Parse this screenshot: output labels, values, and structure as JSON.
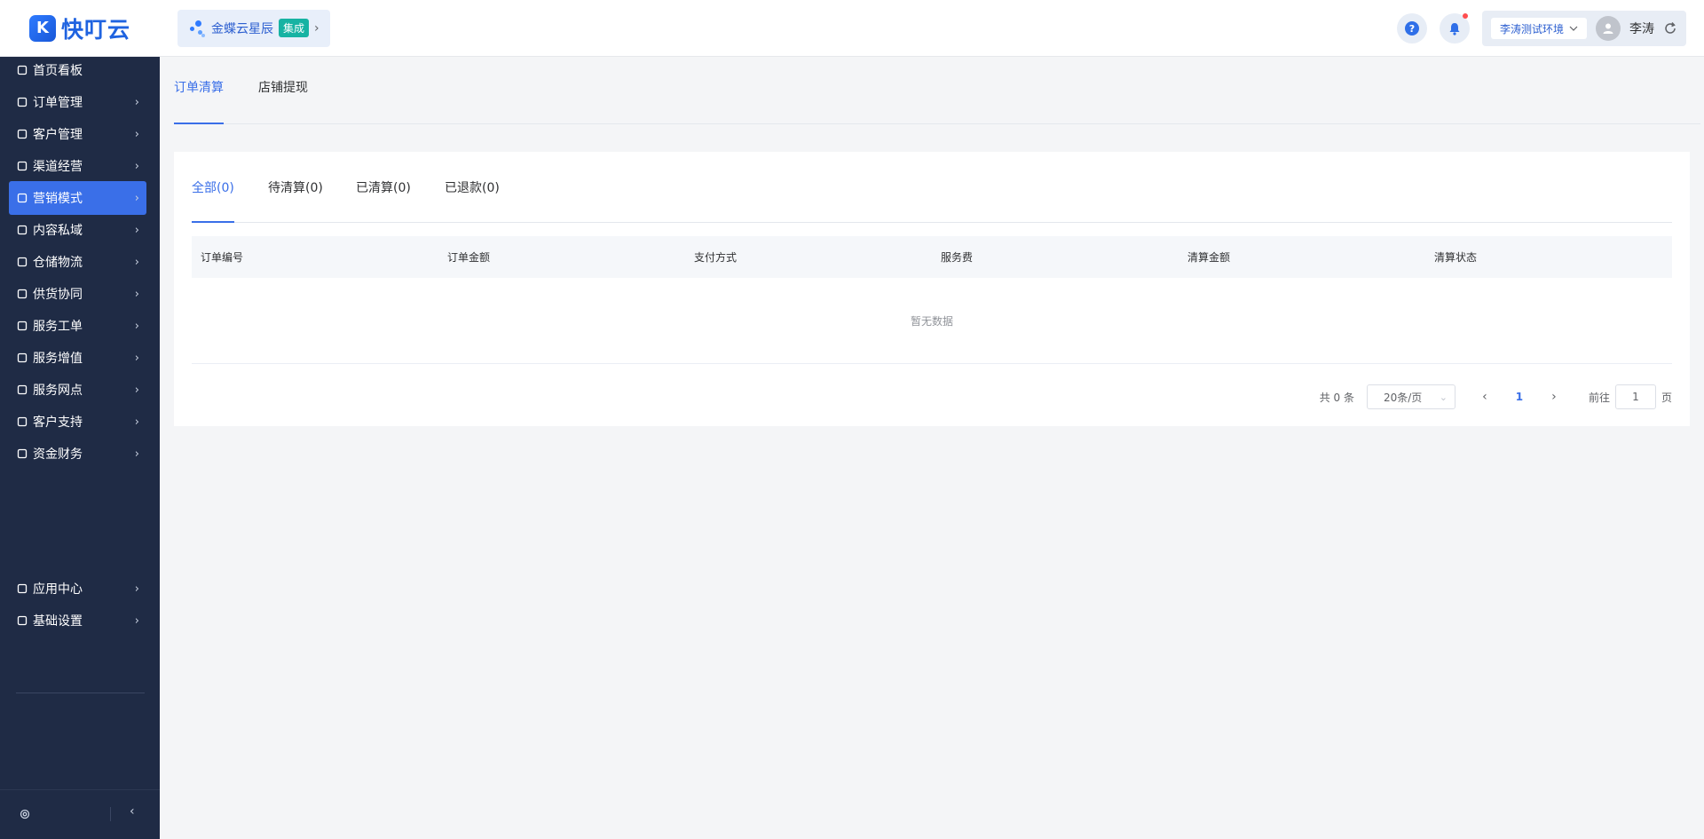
{
  "brand": {
    "logo_glyph": "K",
    "name": "快叮云",
    "color": "#1f63e0"
  },
  "integration": {
    "name": "金蝶云星辰",
    "badge": "集成"
  },
  "header": {
    "env": "李涛测试环境",
    "user": "李涛"
  },
  "sidebar": {
    "items": [
      {
        "label": "首页看板",
        "icon": "home-icon"
      },
      {
        "label": "订单管理",
        "icon": "order-icon"
      },
      {
        "label": "客户管理",
        "icon": "customer-icon"
      },
      {
        "label": "渠道经营",
        "icon": "channel-icon"
      },
      {
        "label": "营销模式",
        "icon": "marketing-icon"
      },
      {
        "label": "内容私域",
        "icon": "content-icon"
      },
      {
        "label": "仓储物流",
        "icon": "warehouse-icon"
      },
      {
        "label": "供货协同",
        "icon": "supply-icon"
      },
      {
        "label": "服务工单",
        "icon": "workorder-icon"
      },
      {
        "label": "服务增值",
        "icon": "value-added-icon"
      },
      {
        "label": "服务网点",
        "icon": "service-point-icon"
      },
      {
        "label": "客户支持",
        "icon": "support-icon"
      },
      {
        "label": "资金财务",
        "icon": "finance-icon"
      }
    ],
    "bottom_items": [
      {
        "label": "应用中心",
        "icon": "app-center-icon"
      },
      {
        "label": "基础设置",
        "icon": "settings-icon"
      }
    ],
    "active_color": "#3a6fe8"
  },
  "tabs": [
    {
      "label": "订单清算"
    },
    {
      "label": "店铺提现"
    }
  ],
  "subtabs": [
    {
      "label": "全部(0)"
    },
    {
      "label": "待清算(0)"
    },
    {
      "label": "已清算(0)"
    },
    {
      "label": "已退款(0)"
    }
  ],
  "table": {
    "columns": [
      "订单编号",
      "订单金额",
      "支付方式",
      "服务费",
      "清算金额",
      "清算状态"
    ],
    "empty_text": "暂无数据"
  },
  "pagination": {
    "total": "共 0 条",
    "page_size": "20条/页",
    "current_page": "1",
    "goto_label": "前往",
    "goto_value": "1",
    "page_unit": "页"
  }
}
